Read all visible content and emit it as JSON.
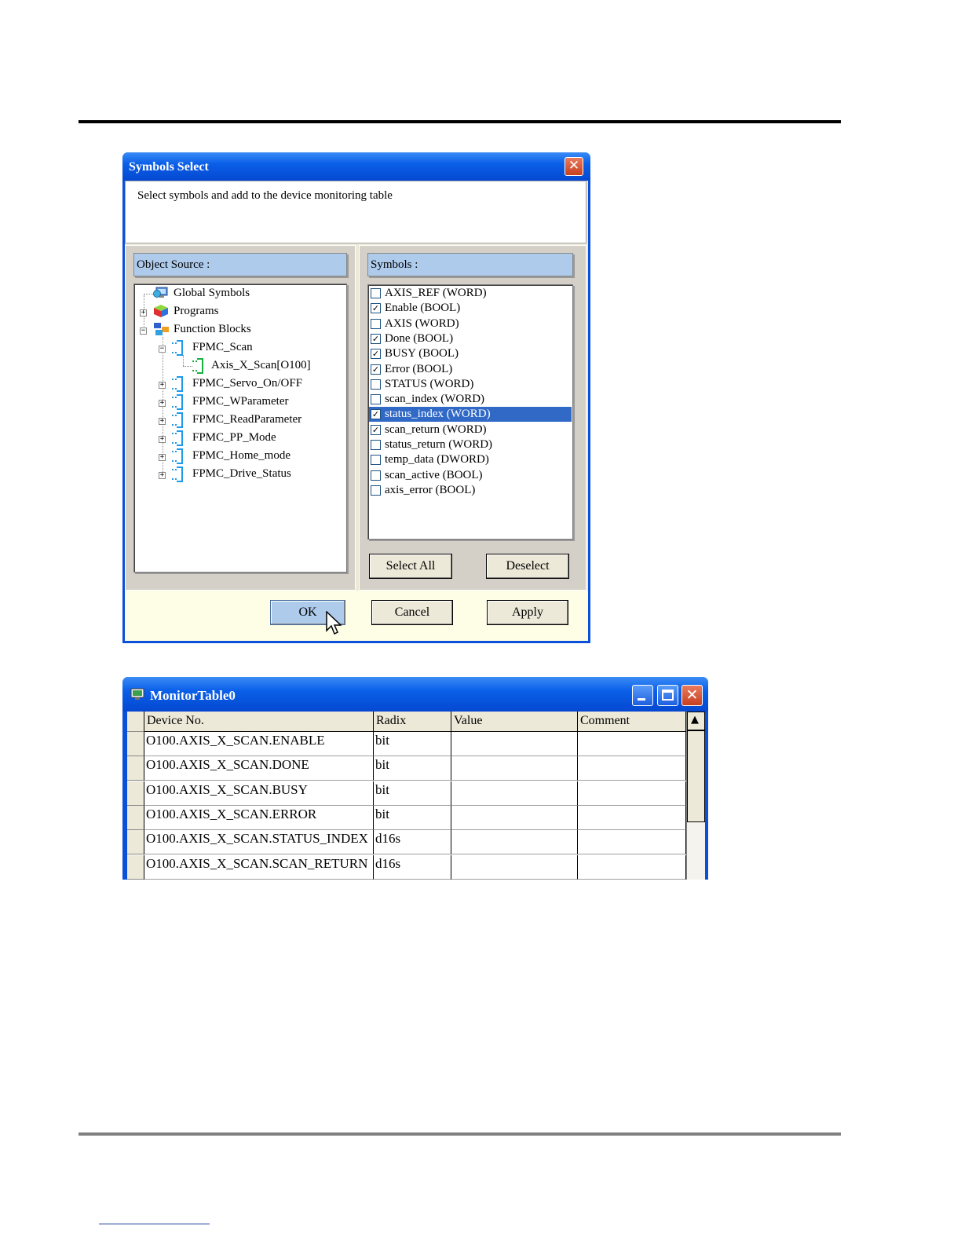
{
  "symbols_dialog": {
    "title": "Symbols Select",
    "close_glyph": "✕",
    "description": "Select symbols and add to the device monitoring table",
    "object_source_label": "Object Source :",
    "symbols_label": "Symbols :",
    "tree": {
      "global_symbols": "Global Symbols",
      "programs": "Programs",
      "function_blocks": "Function Blocks",
      "fpmc_scan": "FPMC_Scan",
      "axis_x_scan": "Axis_X_Scan[O100]",
      "fb_items": [
        "FPMC_Servo_On/OFF",
        "FPMC_WParameter",
        "FPMC_ReadParameter",
        "FPMC_PP_Mode",
        "FPMC_Home_mode",
        "FPMC_Drive_Status"
      ]
    },
    "symbols": [
      {
        "label": "AXIS_REF (WORD)",
        "checked": false
      },
      {
        "label": "Enable (BOOL)",
        "checked": true
      },
      {
        "label": "AXIS (WORD)",
        "checked": false
      },
      {
        "label": "Done (BOOL)",
        "checked": true
      },
      {
        "label": "BUSY (BOOL)",
        "checked": true
      },
      {
        "label": "Error (BOOL)",
        "checked": true
      },
      {
        "label": "STATUS (WORD)",
        "checked": false
      },
      {
        "label": "scan_index (WORD)",
        "checked": false
      },
      {
        "label": "status_index (WORD)",
        "checked": true,
        "selected": true
      },
      {
        "label": "scan_return (WORD)",
        "checked": true
      },
      {
        "label": "status_return (WORD)",
        "checked": false
      },
      {
        "label": "temp_data (DWORD)",
        "checked": false
      },
      {
        "label": "scan_active (BOOL)",
        "checked": false
      },
      {
        "label": "axis_error (BOOL)",
        "checked": false
      }
    ],
    "select_all_label": "Select All",
    "deselect_label": "Deselect",
    "ok_label": "OK",
    "cancel_label": "Cancel",
    "apply_label": "Apply"
  },
  "monitor_table": {
    "title": "MonitorTable0",
    "columns": [
      "Device No.",
      "Radix",
      "Value",
      "Comment"
    ],
    "rows": [
      {
        "device": "O100.AXIS_X_SCAN.ENABLE",
        "radix": "bit",
        "value": "",
        "comment": ""
      },
      {
        "device": "O100.AXIS_X_SCAN.DONE",
        "radix": "bit",
        "value": "",
        "comment": ""
      },
      {
        "device": "O100.AXIS_X_SCAN.BUSY",
        "radix": "bit",
        "value": "",
        "comment": ""
      },
      {
        "device": "O100.AXIS_X_SCAN.ERROR",
        "radix": "bit",
        "value": "",
        "comment": ""
      },
      {
        "device": "O100.AXIS_X_SCAN.STATUS_INDEX",
        "radix": "d16s",
        "value": "",
        "comment": ""
      },
      {
        "device": "O100.AXIS_X_SCAN.SCAN_RETURN",
        "radix": "d16s",
        "value": "",
        "comment": ""
      }
    ],
    "close_glyph": "✕",
    "scroll_up_glyph": "▲"
  },
  "colors": {
    "titlebar": "#0a5fe8",
    "selection": "#3169c6",
    "header_fill": "#aecbec"
  }
}
